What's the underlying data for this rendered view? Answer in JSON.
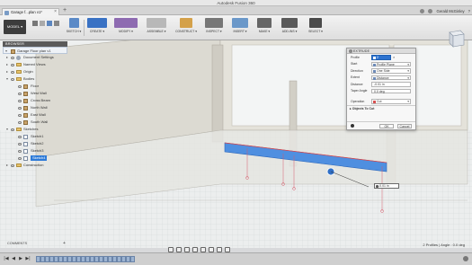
{
  "window": {
    "title": "Autodesk Fusion 360"
  },
  "tab": {
    "label": "Garage f...plan v1*",
    "close": "×"
  },
  "user": {
    "name": "Gerald McGinley",
    "help": "?"
  },
  "toolbar": {
    "workspace": "MODEL ▾",
    "groups": [
      "SKETCH ▾",
      "CREATE ▾",
      "MODIFY ▾",
      "ASSEMBLE ▾",
      "CONSTRUCT ▾",
      "INSPECT ▾",
      "INSERT ▾",
      "MAKE ▾",
      "ADD-INS ▾",
      "SELECT ▾"
    ]
  },
  "browser": {
    "header": "BROWSER",
    "root": "Garage Floor plan v1",
    "items": [
      {
        "label": "Document Settings",
        "level": 1,
        "icon": "gear-icon",
        "arrow": "▸"
      },
      {
        "label": "Named Views",
        "level": 1,
        "icon": "folder-icon",
        "arrow": "▸"
      },
      {
        "label": "Origin",
        "level": 1,
        "icon": "folder-icon",
        "arrow": "▸"
      },
      {
        "label": "Bodies",
        "level": 1,
        "icon": "folder-icon",
        "arrow": "▾"
      },
      {
        "label": "Floor",
        "level": 2,
        "icon": "body-icon",
        "arrow": ""
      },
      {
        "label": "West Wall",
        "level": 2,
        "icon": "body-icon",
        "arrow": ""
      },
      {
        "label": "Cross Beam",
        "level": 2,
        "icon": "body-icon",
        "arrow": ""
      },
      {
        "label": "North Wall",
        "level": 2,
        "icon": "body-icon",
        "arrow": ""
      },
      {
        "label": "East Wall",
        "level": 2,
        "icon": "body-icon",
        "arrow": ""
      },
      {
        "label": "South Wall",
        "level": 2,
        "icon": "body-icon",
        "arrow": ""
      },
      {
        "label": "Sketches",
        "level": 1,
        "icon": "folder-icon",
        "arrow": "▾"
      },
      {
        "label": "Sketch1",
        "level": 2,
        "icon": "sketch-icon",
        "arrow": ""
      },
      {
        "label": "Sketch2",
        "level": 2,
        "icon": "sketch-icon",
        "arrow": ""
      },
      {
        "label": "Sketch3",
        "level": 2,
        "icon": "sketch-icon",
        "arrow": ""
      },
      {
        "label": "Sketch4",
        "level": 2,
        "icon": "sketch-icon",
        "arrow": "",
        "selected": true
      },
      {
        "label": "Construction",
        "level": 1,
        "icon": "folder-icon",
        "arrow": "▸"
      }
    ]
  },
  "extrude": {
    "title": "EXTRUDE",
    "profile": {
      "label": "Profile",
      "value": "2 selected"
    },
    "start": {
      "label": "Start",
      "value": "Profile Plane"
    },
    "direction": {
      "label": "Direction",
      "value": "One Side"
    },
    "extent": {
      "label": "Extent",
      "value": "Distance"
    },
    "distance": {
      "label": "Distance",
      "value": "-0.01 in"
    },
    "taper": {
      "label": "Taper Angle",
      "value": "0.0 deg"
    },
    "operation": {
      "label": "Operation",
      "value": "Cut"
    },
    "objects": "▸ Objects To Cut",
    "ok": "OK",
    "cancel": "Cancel"
  },
  "viewport_input": {
    "value": "-0.01 in"
  },
  "comments": {
    "label": "COMMENTS",
    "plus": "+"
  },
  "status": {
    "text": "2 Profiles | Angle : 0.0 deg"
  },
  "timeline": {
    "controls": [
      "|◀",
      "◀",
      "▶",
      "▶|"
    ]
  },
  "colors": {
    "accent": "#2c72cf",
    "selection_edge": "#3d86e0",
    "workspace_bg": "#3c3c3c"
  }
}
